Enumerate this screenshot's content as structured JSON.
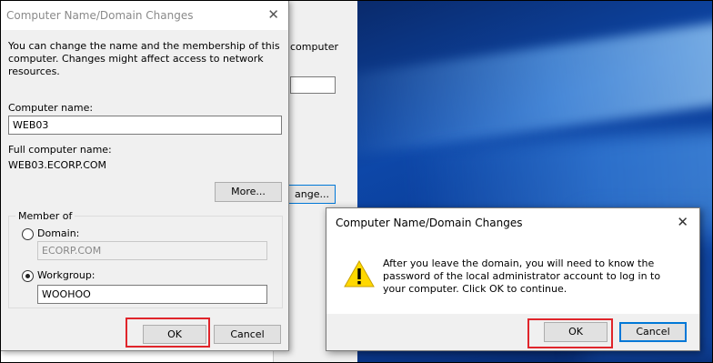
{
  "background_window": {
    "partial_text": "computer",
    "button_label": "ange..."
  },
  "dialog_main": {
    "title": "Computer Name/Domain Changes",
    "close_glyph": "✕",
    "description": "You can change the name and the membership of this computer. Changes might affect access to network resources.",
    "computer_name_label": "Computer name:",
    "computer_name_value": "WEB03",
    "full_name_label": "Full computer name:",
    "full_name_value": "WEB03.ECORP.COM",
    "more_button": "More...",
    "member_of_label": "Member of",
    "domain_label": "Domain:",
    "domain_value": "ECORP.COM",
    "workgroup_label": "Workgroup:",
    "workgroup_value": "WOOHOO",
    "selected_membership": "Workgroup",
    "ok_label": "OK",
    "cancel_label": "Cancel"
  },
  "dialog_confirm": {
    "title": "Computer Name/Domain Changes",
    "close_glyph": "✕",
    "message": "After you leave the domain, you will need to know the password of the local administrator account to log in to your computer. Click OK to continue.",
    "icon": "warning-icon",
    "ok_label": "OK",
    "cancel_label": "Cancel"
  },
  "colors": {
    "highlight": "#e0252b",
    "accent": "#0078d7",
    "warning": "#ffd800"
  }
}
